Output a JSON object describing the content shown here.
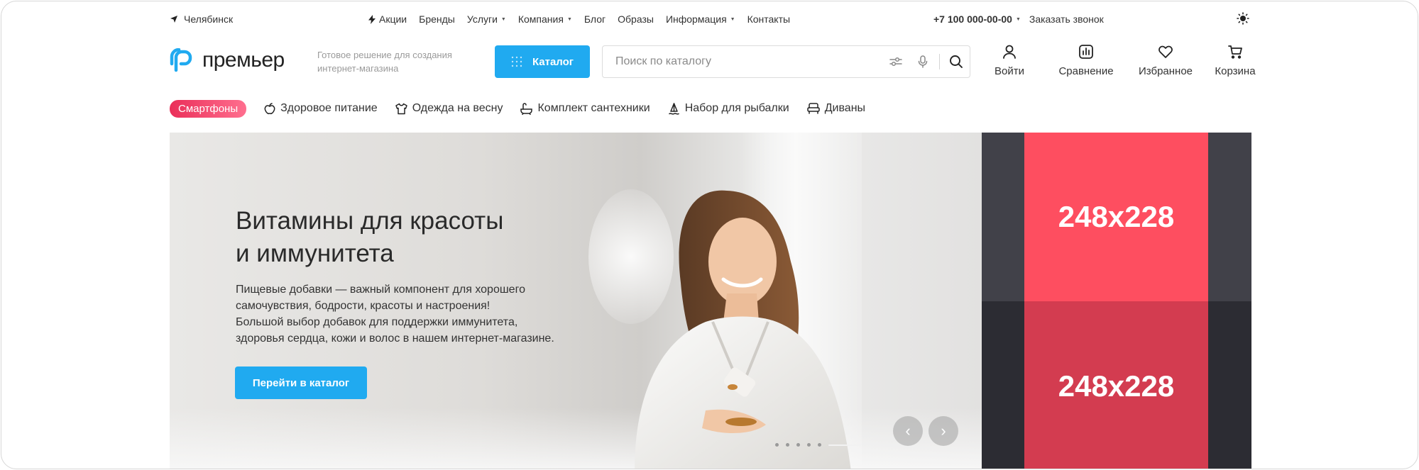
{
  "topbar": {
    "city": "Челябинск",
    "nav": [
      {
        "label": "Акции",
        "has_icon": true,
        "dropdown": false
      },
      {
        "label": "Бренды",
        "dropdown": false
      },
      {
        "label": "Услуги",
        "dropdown": true
      },
      {
        "label": "Компания",
        "dropdown": true
      },
      {
        "label": "Блог",
        "dropdown": false
      },
      {
        "label": "Образы",
        "dropdown": false
      },
      {
        "label": "Информация",
        "dropdown": true
      },
      {
        "label": "Контакты",
        "dropdown": false
      }
    ],
    "phone": "+7 100 000-00-00",
    "callback": "Заказать звонок",
    "theme_icon": "sun-icon"
  },
  "header": {
    "logo_text": "премьер",
    "tagline": "Готовое решение для создания интернет-магазина",
    "catalog_label": "Каталог",
    "search_placeholder": "Поиск по каталогу",
    "actions": [
      {
        "label": "Войти",
        "icon": "user-icon"
      },
      {
        "label": "Сравнение",
        "icon": "compare-chart-icon"
      },
      {
        "label": "Избранное",
        "icon": "heart-icon"
      },
      {
        "label": "Корзина",
        "icon": "cart-icon"
      }
    ]
  },
  "chips": [
    {
      "label": "Смартфоны",
      "highlight": true
    },
    {
      "label": "Здоровое питание",
      "icon": "apple-icon"
    },
    {
      "label": "Одежда на весну",
      "icon": "shirt-icon"
    },
    {
      "label": "Комплект сантехники",
      "icon": "bathtub-icon"
    },
    {
      "label": "Набор для рыбалки",
      "icon": "fishing-icon"
    },
    {
      "label": "Диваны",
      "icon": "sofa-icon"
    }
  ],
  "hero": {
    "title_line1": "Витамины для красоты",
    "title_line2": "и иммунитета",
    "text_lines": [
      "Пищевые добавки — важный компонент для хорошего",
      "самочувствия, бодрости, красоты и настроения!",
      "Большой выбор добавок для поддержки иммунитета,",
      "здоровья сердца, кожи и волос в нашем интернет-магазине."
    ],
    "button_label": "Перейти в каталог",
    "slide_count": 6,
    "active_slide": 6
  },
  "banners": [
    {
      "label": "248x228"
    },
    {
      "label": "248x228"
    }
  ],
  "colors": {
    "accent": "#20aaf0",
    "banner_top": "#fe4e60",
    "banner_bottom": "#d33c50",
    "chip_hot": "#ea2f59"
  }
}
